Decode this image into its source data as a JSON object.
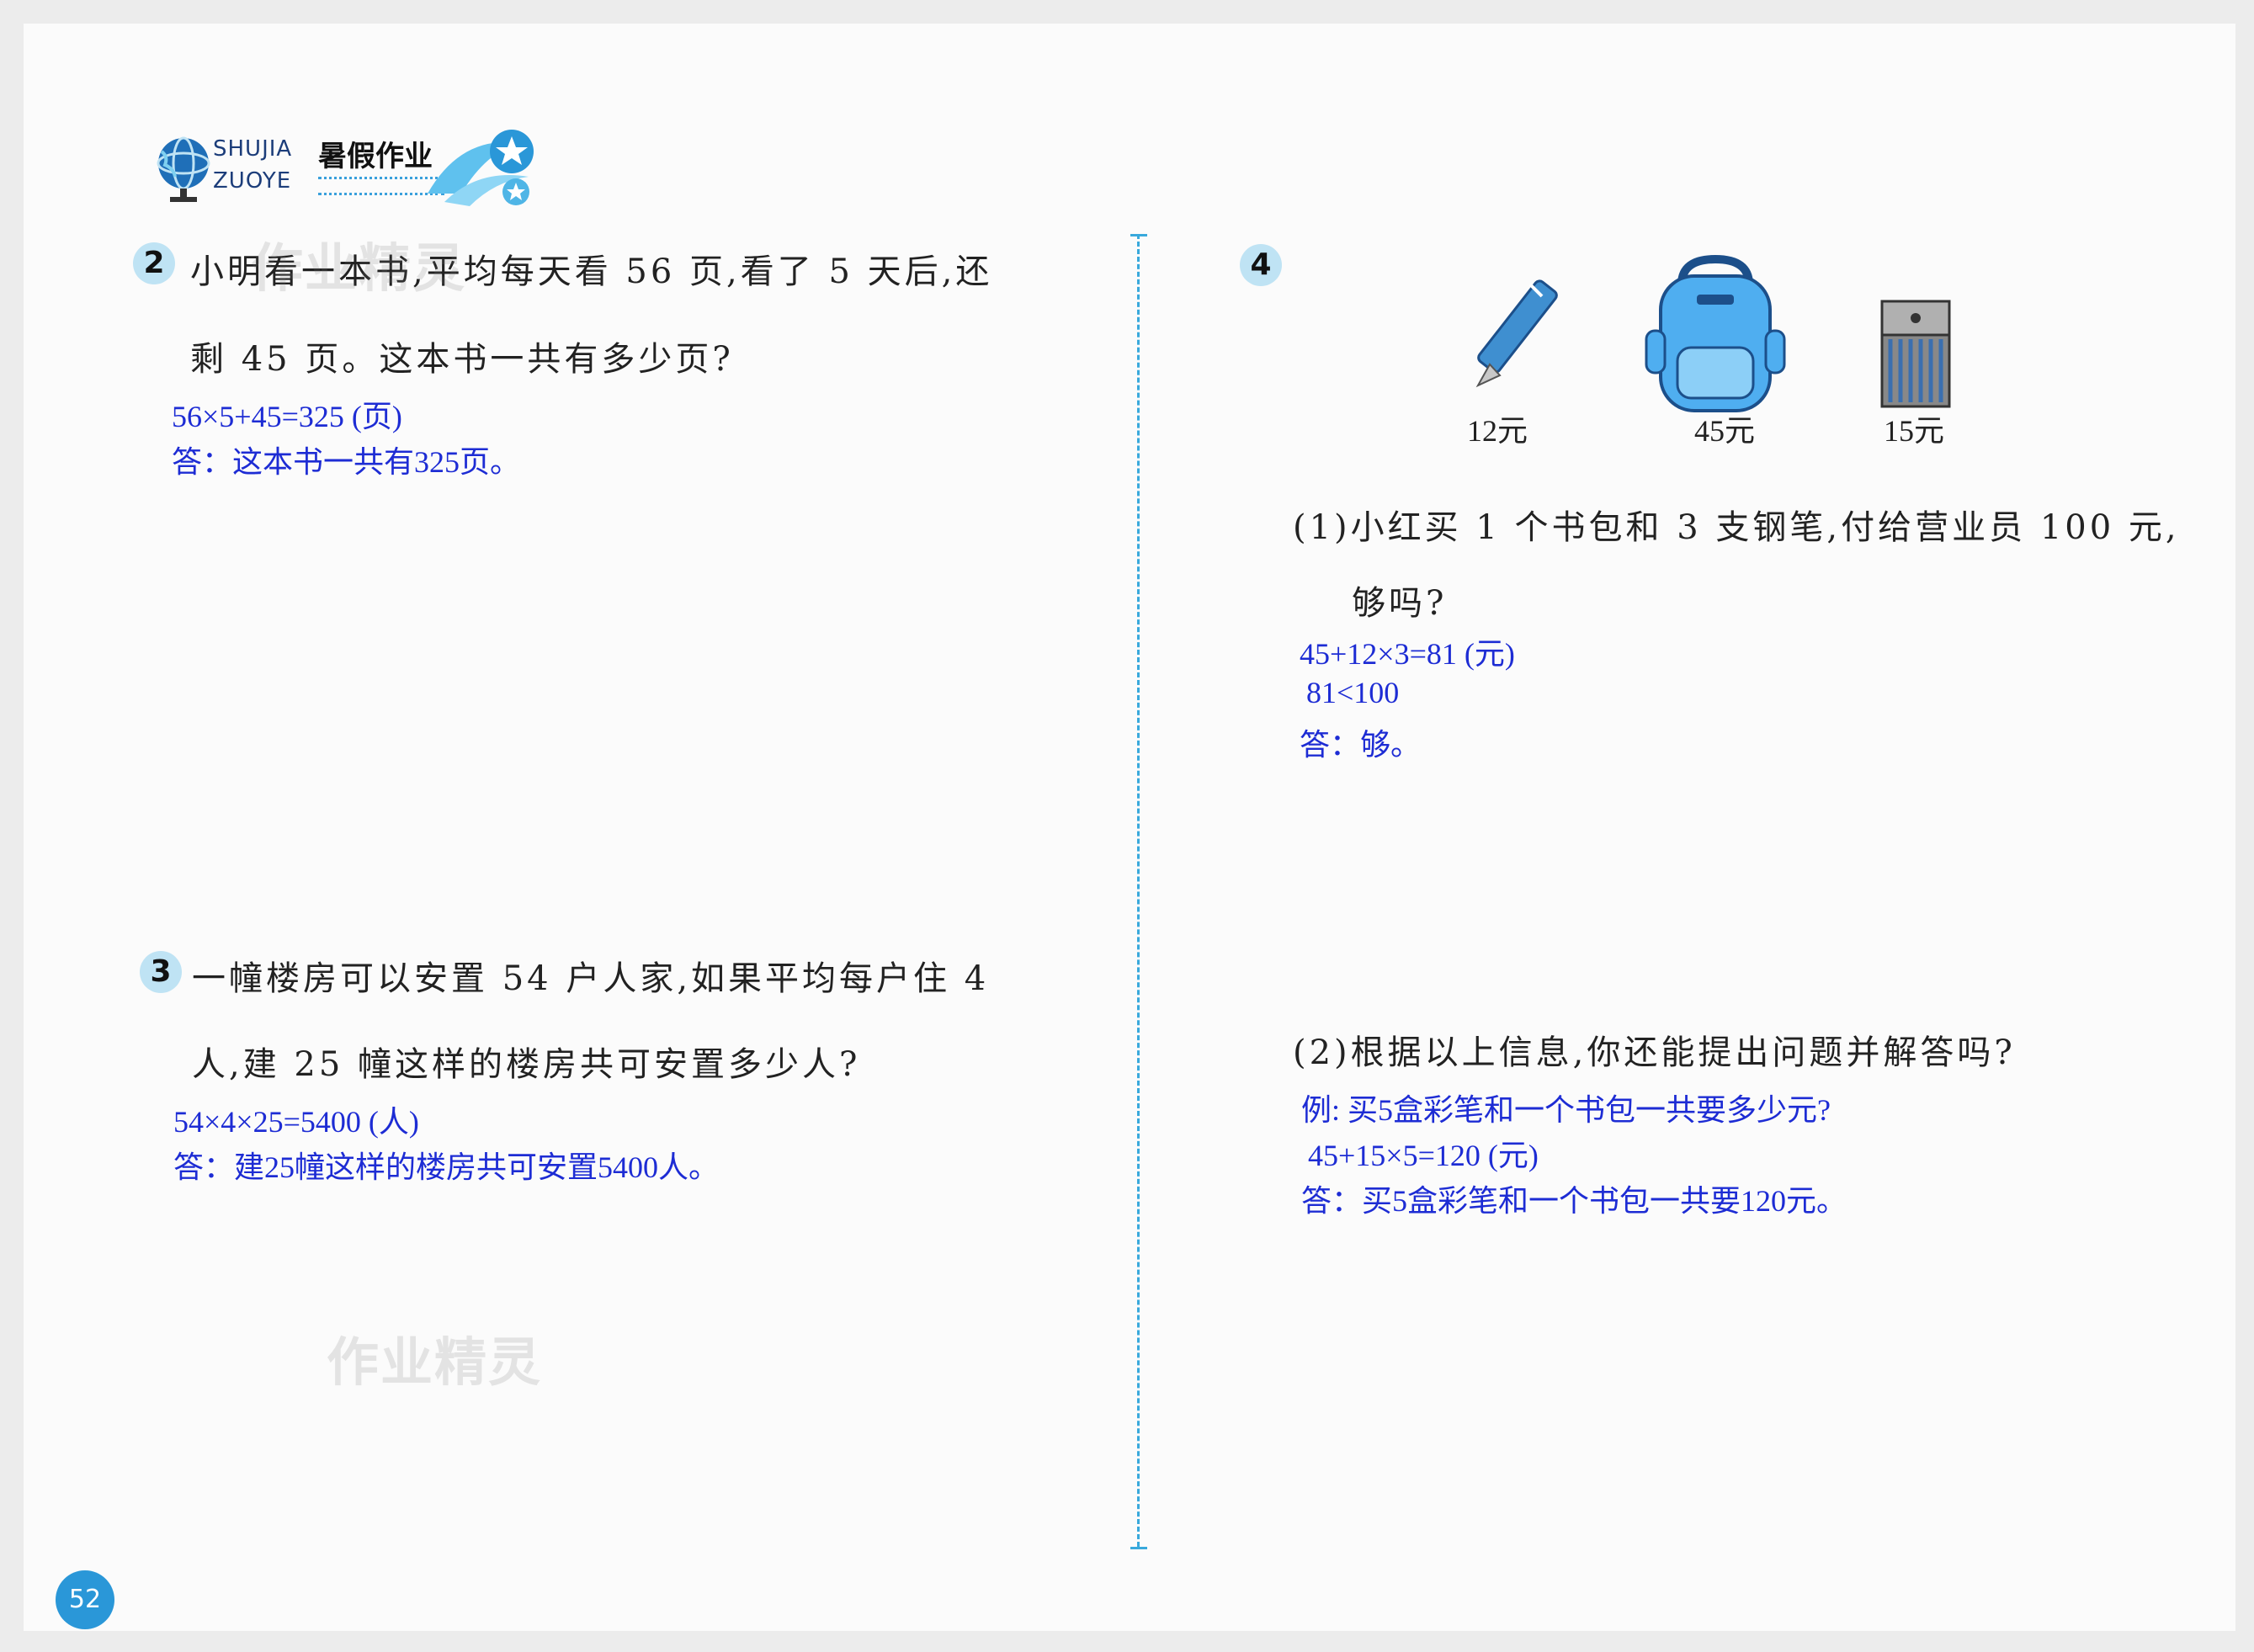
{
  "header": {
    "brand_en_line1": "SHUJIA",
    "brand_en_line2": "ZUOYE",
    "brand_cn": "暑假作业"
  },
  "watermark": "作业精灵",
  "q2": {
    "number": "2",
    "line1": "小明看一本书,平均每天看 56 页,看了 5 天后,还",
    "line2": "剩 45 页。这本书一共有多少页?",
    "answer_line1": "56×5+45=325 (页)",
    "answer_line2": "答：这本书一共有325页。"
  },
  "q3": {
    "number": "3",
    "line1": "一幢楼房可以安置 54 户人家,如果平均每户住 4",
    "line2": "人,建 25 幢这样的楼房共可安置多少人?",
    "answer_line1": "54×4×25=5400 (人)",
    "answer_line2": "答：建25幢这样的楼房共可安置5400人。"
  },
  "q4": {
    "number": "4",
    "items": [
      {
        "icon": "pen-icon",
        "price": "12元"
      },
      {
        "icon": "backpack-icon",
        "price": "45元"
      },
      {
        "icon": "crayon-box-icon",
        "price": "15元"
      }
    ],
    "part1_line1": "(1)小红买 1 个书包和 3 支钢笔,付给营业员 100 元,",
    "part1_line2": "够吗?",
    "part1_answer_line1": "45+12×3=81 (元)",
    "part1_answer_line2": "81<100",
    "part1_answer_line3": "答：够。",
    "part2_line1": "(2)根据以上信息,你还能提出问题并解答吗?",
    "part2_answer_line1": "例: 买5盒彩笔和一个书包一共要多少元?",
    "part2_answer_line2": "45+15×5=120 (元)",
    "part2_answer_line3": "答：买5盒彩笔和一个书包一共要120元。"
  },
  "page_number": "52",
  "colors": {
    "answer": "#1d2cd4",
    "accent": "#39a9dc",
    "badge": "#bfe3f4"
  }
}
